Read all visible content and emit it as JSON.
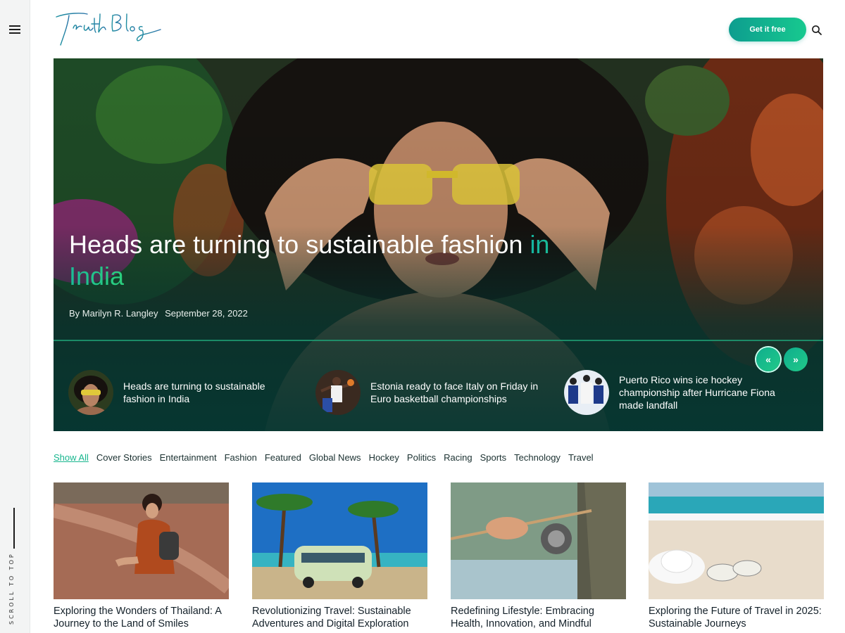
{
  "header": {
    "logo_text": "TruthBlog",
    "cta_label": "Get it free"
  },
  "rail": {
    "scroll_label": "SCROLL TO TOP"
  },
  "hero": {
    "title_main": "Heads are turning to sustainable fashion",
    "title_accent": "in India",
    "author": "By Marilyn R. Langley",
    "date": "September 28, 2022",
    "prev_label": "«",
    "next_label": "»"
  },
  "slides": [
    {
      "title": "Heads are turning to sustainable fashion in India"
    },
    {
      "title": "Estonia ready to face Italy on Friday in Euro basketball championships"
    },
    {
      "title": "Puerto Rico wins ice hockey championship after Hurricane Fiona made landfall"
    }
  ],
  "categories": [
    "Show All",
    "Cover Stories",
    "Entertainment",
    "Fashion",
    "Featured",
    "Global News",
    "Hockey",
    "Politics",
    "Racing",
    "Sports",
    "Technology",
    "Travel"
  ],
  "articles": [
    {
      "title": "Exploring the Wonders of Thailand: A Journey to the Land of Smiles"
    },
    {
      "title": "Revolutionizing Travel: Sustainable Adventures and Digital Exploration"
    },
    {
      "title": "Redefining Lifestyle: Embracing Health, Innovation, and Mindful"
    },
    {
      "title": "Exploring the Future of Travel in 2025: Sustainable Journeys"
    }
  ],
  "colors": {
    "accent_start": "#0d9d8f",
    "accent_end": "#17c98f",
    "hero_overlay": "#06322e"
  },
  "icons": {
    "menu": "hamburger-icon",
    "search": "search-icon",
    "prev": "double-chevron-left-icon",
    "next": "double-chevron-right-icon"
  }
}
